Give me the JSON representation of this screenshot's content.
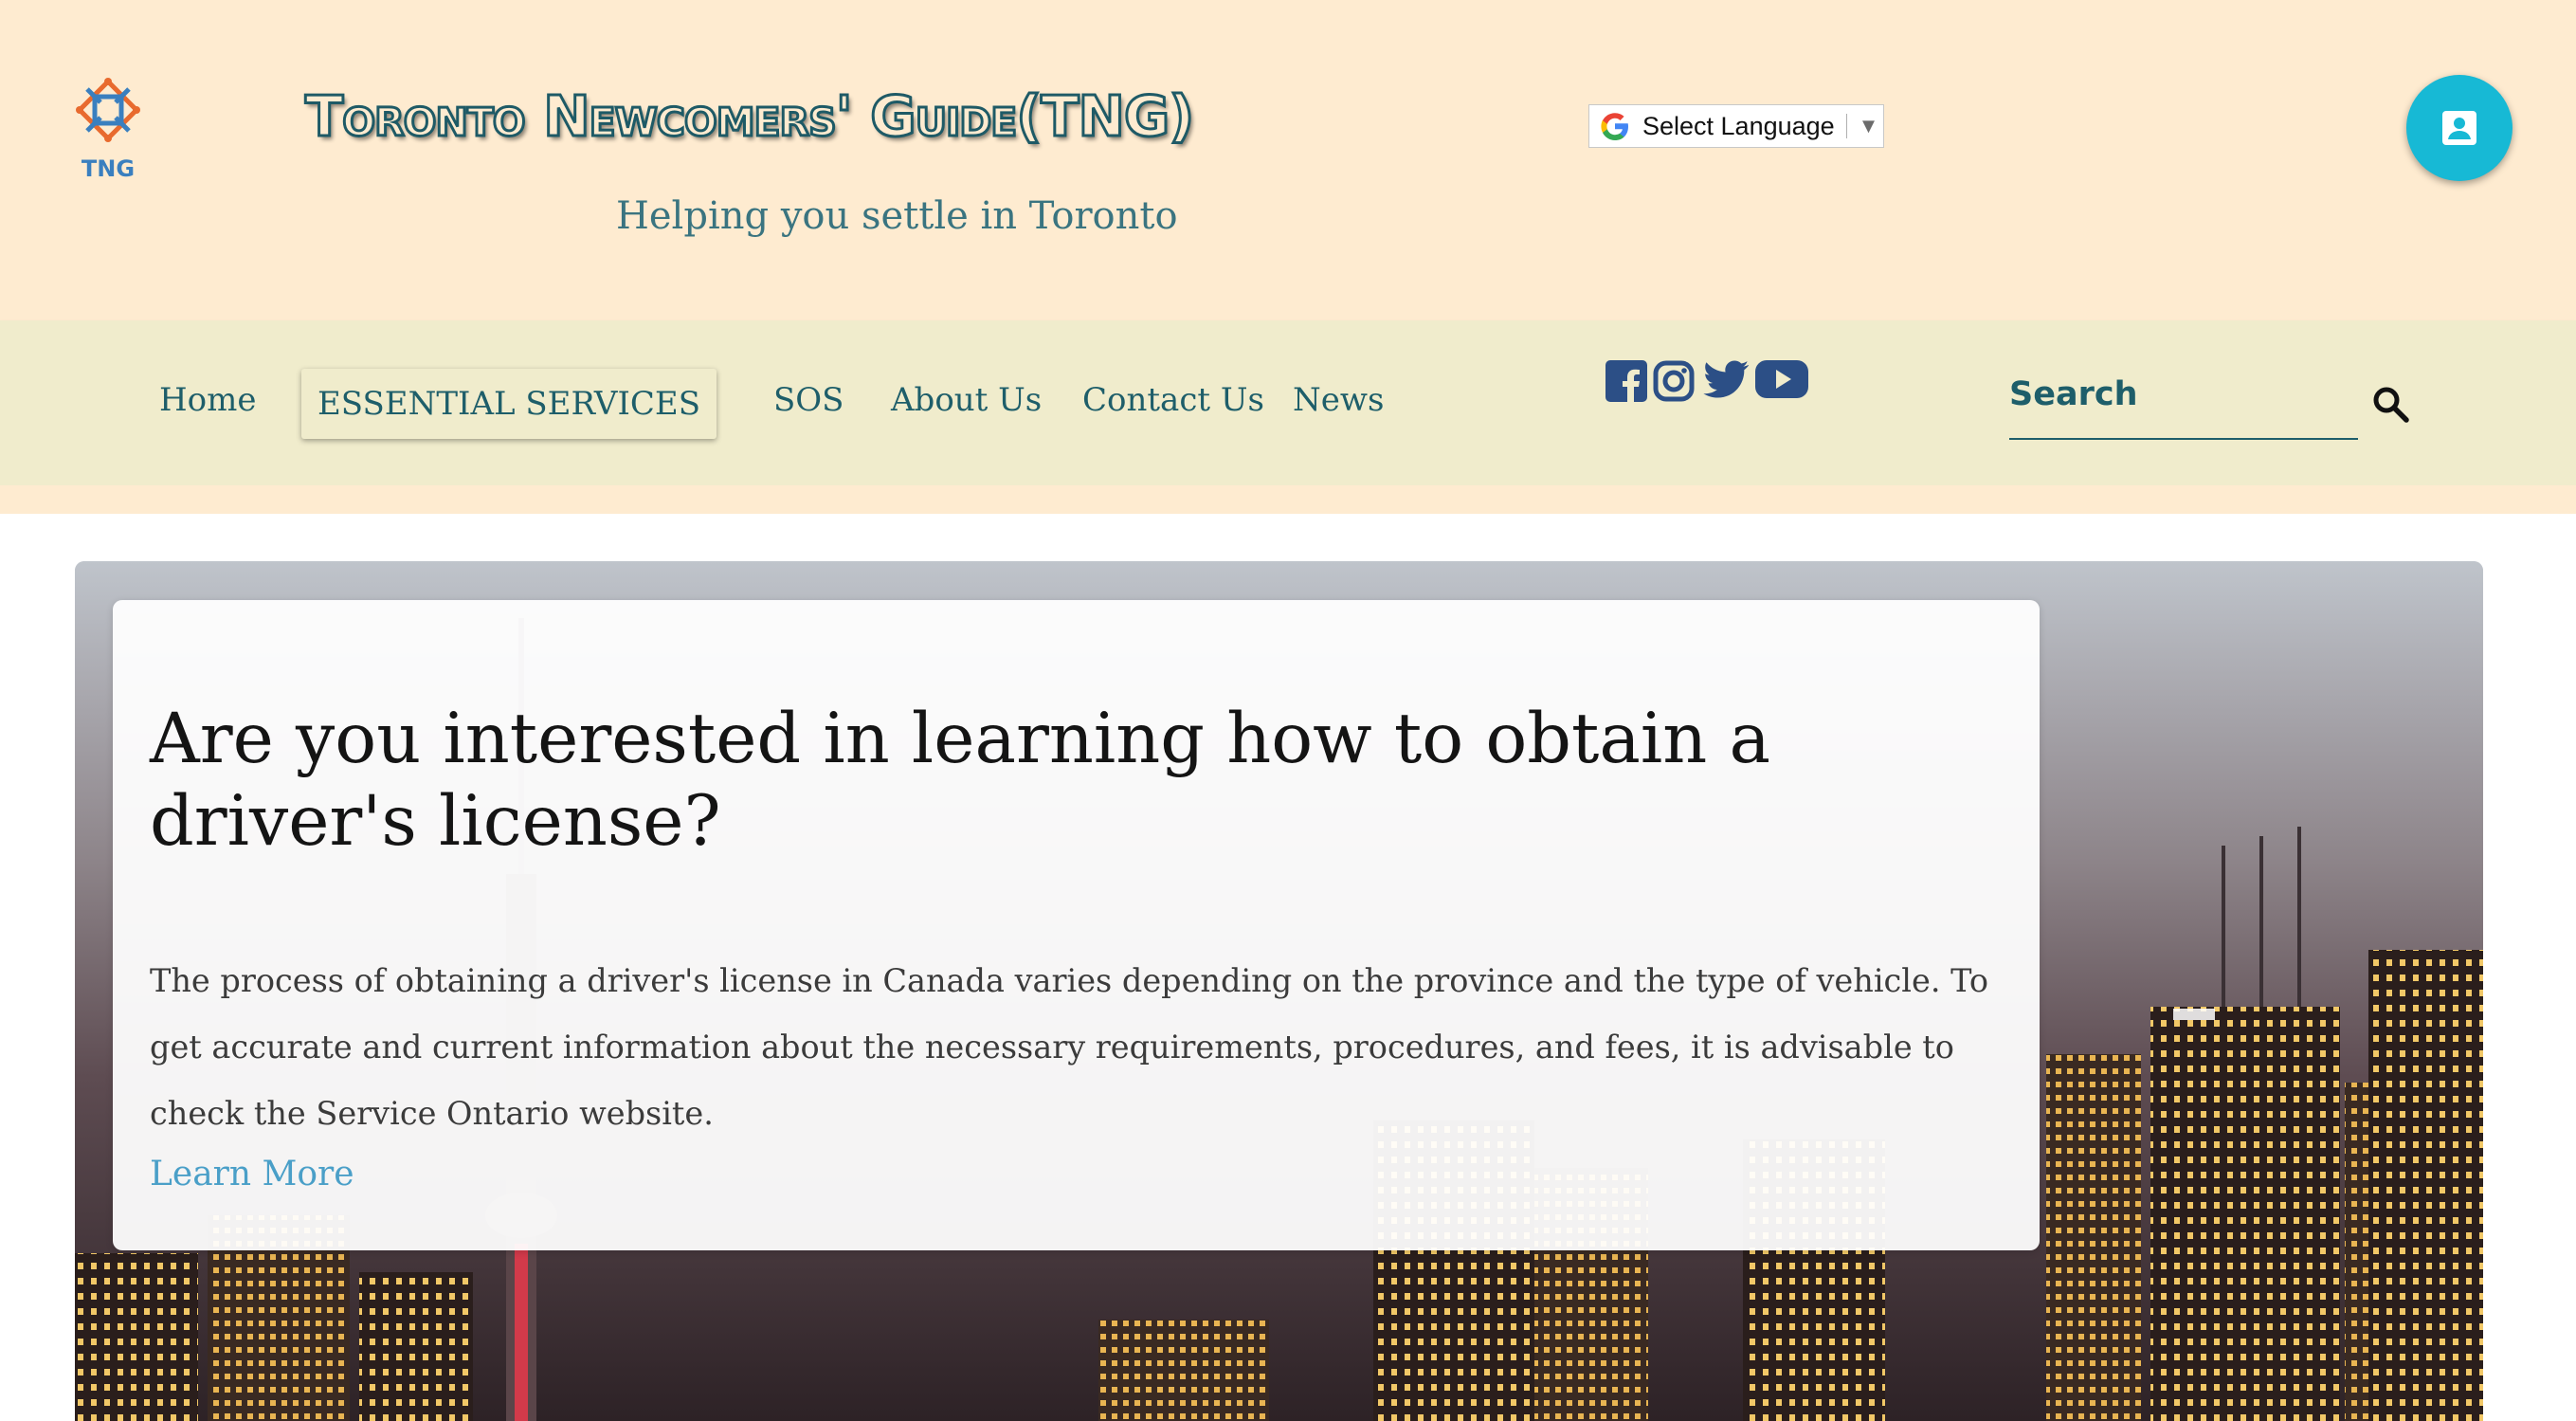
{
  "header": {
    "logo_text": "TNG",
    "title": "Toronto Newcomers' Guide(TNG)",
    "tagline": "Helping you settle in Toronto",
    "language_select": "Select Language"
  },
  "nav": {
    "items": [
      "Home",
      "ESSENTIAL SERVICES",
      "SOS",
      "About Us",
      "Contact Us",
      "News"
    ],
    "active": "ESSENTIAL SERVICES",
    "social_icons": [
      "facebook-icon",
      "instagram-icon",
      "twitter-icon",
      "youtube-icon"
    ],
    "search_placeholder": "Search"
  },
  "hero": {
    "title": "Are you interested in learning how to obtain a driver's license?",
    "body": "The process of obtaining a driver's license in Canada varies depending on the province and the type of vehicle. To get accurate and current information about the necessary requirements, procedures, and fees, it is advisable to check the Service Ontario website.",
    "link": "Learn More"
  },
  "colors": {
    "header_bg": "#feebd0",
    "nav_bg": "#f0eccc",
    "text_teal": "#1e5e6a",
    "accent_cyan": "#17b9d5",
    "link_blue": "#4a9fc8",
    "social_blue": "#2c4f86"
  }
}
